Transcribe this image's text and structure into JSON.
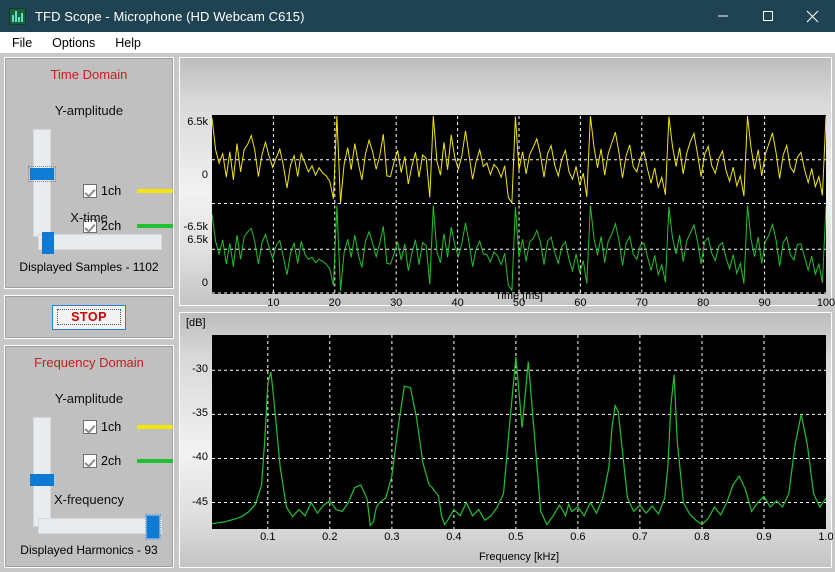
{
  "window": {
    "title": "TFD Scope - Microphone (HD Webcam C615)",
    "icon": "bar-chart-icon",
    "minimize": "minimize-icon",
    "maximize": "maximize-icon",
    "close": "close-icon"
  },
  "menu": {
    "items": [
      "File",
      "Options",
      "Help"
    ]
  },
  "time_domain": {
    "title": "Time Domain",
    "y_label": "Y-amplitude",
    "x_label": "X-time",
    "ch1": {
      "label": "1ch",
      "checked": true,
      "color": "#f3e600"
    },
    "ch2": {
      "label": "2ch",
      "checked": true,
      "color": "#22c030"
    },
    "readout": "Displayed Samples - 1102",
    "y_slider_value": 62,
    "x_slider_value": 3
  },
  "transport": {
    "stop_label": "STOP",
    "stop_color": "#cc0000"
  },
  "frequency_domain": {
    "title": "Frequency Domain",
    "y_label": "Y-amplitude",
    "x_label": "X-frequency",
    "ch1": {
      "label": "1ch",
      "checked": true,
      "color": "#f3e600"
    },
    "ch2": {
      "label": "2ch",
      "checked": true,
      "color": "#22c030"
    },
    "readout": "Displayed Harmonics - 93",
    "y_slider_value": 55,
    "x_slider_value": 97
  },
  "chart_data": [
    {
      "type": "line",
      "name": "time-domain-ch1",
      "title": "",
      "xlabel": "Time [ms]",
      "ylabel": "",
      "xlim": [
        0,
        100
      ],
      "ylim": [
        -6500,
        6500
      ],
      "ytick_labels": [
        "6.5k",
        "0",
        "-6.5k"
      ],
      "ytick_values": [
        6500,
        0,
        -6500
      ],
      "xtick_labels": [
        "10",
        "20",
        "30",
        "40",
        "50",
        "60",
        "70",
        "80",
        "90",
        "100"
      ],
      "xtick_values": [
        10,
        20,
        30,
        40,
        50,
        60,
        70,
        80,
        90,
        100
      ],
      "grid": true,
      "series_color": "#f3e600",
      "background": "#000000",
      "values": [
        6200,
        1500,
        -500,
        900,
        -2600,
        1200,
        -3000,
        2400,
        -1800,
        1500,
        2300,
        3600,
        1400,
        -2500,
        800,
        2600,
        500,
        -1100,
        300,
        1600,
        -900,
        -4200,
        -800,
        600,
        -2500,
        900,
        -400,
        -1800,
        -900,
        -2300,
        -1200,
        -2000,
        -2400,
        -3200,
        -5800,
        6500,
        -6400,
        -700,
        1800,
        -1500,
        2400,
        -600,
        -3000,
        900,
        2900,
        1200,
        -1400,
        600,
        3800,
        -2400,
        -2500,
        -300,
        1400,
        -1900,
        500,
        -3600,
        -900,
        1100,
        -2600,
        700,
        200,
        -5600,
        6500,
        -200,
        -2300,
        2600,
        -1500,
        3700,
        400,
        -1400,
        600,
        4300,
        700,
        -2900,
        -200,
        1500,
        -1000,
        -500,
        -2200,
        -700,
        -1300,
        -2600,
        -900,
        -5600,
        -6400,
        6400,
        -1500,
        1200,
        -2100,
        800,
        1900,
        3100,
        800,
        -2600,
        900,
        2100,
        -800,
        -2400,
        100,
        1400,
        -1800,
        -2900,
        -1000,
        -3800,
        -2000,
        -5500,
        6500,
        1900,
        -1200,
        1600,
        -2300,
        900,
        2500,
        4100,
        1000,
        -2700,
        600,
        2200,
        -1000,
        -1800,
        300,
        1200,
        -1400,
        -3500,
        -1200,
        -4100,
        -2600,
        -5200,
        6400,
        2000,
        -1000,
        1800,
        -2100,
        1000,
        2700,
        3900,
        900,
        -2500,
        800,
        2000,
        -900,
        -2000,
        200,
        1300,
        -1600,
        -3200,
        -1100,
        -3900,
        -2400,
        -5400,
        6500,
        1800,
        -1400,
        1500,
        -2400,
        800,
        2400,
        4000,
        1100,
        -2800,
        700,
        2100,
        -1100,
        -1900,
        400,
        1100,
        -1500,
        -3400,
        -1300,
        -4000,
        -2500,
        -5300,
        6500
      ]
    },
    {
      "type": "line",
      "name": "time-domain-ch2",
      "title": "",
      "xlabel": "Time [ms]",
      "ylabel": "",
      "xlim": [
        0,
        100
      ],
      "ylim": [
        -6500,
        6500
      ],
      "ytick_labels": [
        "6.5k",
        "0",
        "-6.5k"
      ],
      "ytick_values": [
        6500,
        0,
        -6500
      ],
      "grid": true,
      "series_color": "#22c030",
      "background": "#000000",
      "values": [
        5200,
        1200,
        -800,
        1400,
        -2200,
        900,
        -2600,
        2100,
        -1500,
        1800,
        2600,
        3100,
        1100,
        -2200,
        1000,
        2200,
        300,
        -1400,
        600,
        1300,
        -1200,
        -3800,
        -600,
        900,
        -2100,
        1200,
        -700,
        -1500,
        -1200,
        -2000,
        -1500,
        -1800,
        -2200,
        -2900,
        -5400,
        6500,
        -6200,
        -500,
        1500,
        -1200,
        2100,
        -900,
        -2700,
        1200,
        2600,
        900,
        -1100,
        900,
        3400,
        -2100,
        -2200,
        -600,
        1100,
        -1600,
        800,
        -3200,
        -600,
        1400,
        -2300,
        1000,
        500,
        -5200,
        6500,
        -400,
        -2000,
        2300,
        -1200,
        3300,
        700,
        -1100,
        900,
        3900,
        1000,
        -2600,
        100,
        1200,
        -700,
        -800,
        -1900,
        -400,
        -1000,
        -2300,
        -600,
        -5300,
        -6100,
        6300,
        -1200,
        1500,
        -1800,
        1100,
        1600,
        2800,
        1100,
        -2300,
        1200,
        1800,
        -500,
        -2100,
        400,
        1100,
        -1500,
        -3200,
        -700,
        -3500,
        -1700,
        -5100,
        6500,
        1600,
        -900,
        1900,
        -2000,
        1200,
        2200,
        3800,
        1300,
        -2400,
        900,
        1900,
        -700,
        -1500,
        600,
        900,
        -1100,
        -3200,
        -900,
        -3800,
        -2300,
        -4900,
        6300,
        1700,
        -700,
        2100,
        -1800,
        1300,
        2400,
        3600,
        1200,
        -2200,
        1100,
        1700,
        -600,
        -1700,
        500,
        1000,
        -1300,
        -2900,
        -800,
        -3600,
        -2100,
        -5100,
        6500,
        1500,
        -1100,
        1800,
        -2100,
        1100,
        2100,
        3700,
        1400,
        -2500,
        1000,
        1800,
        -800,
        -1600,
        700,
        800,
        -1200,
        -3100,
        -1000,
        -3700,
        -2200,
        -5000,
        6400
      ]
    },
    {
      "type": "line",
      "name": "frequency-domain-spectrum",
      "title": "",
      "xlabel": "Frequency [kHz]",
      "ylabel": "[dB]",
      "xlim": [
        0.01,
        1.0
      ],
      "ylim": [
        -48,
        -26
      ],
      "ytick_labels": [
        "-30",
        "-35",
        "-40",
        "-45"
      ],
      "ytick_values": [
        -30,
        -35,
        -40,
        -45
      ],
      "xtick_labels": [
        "0.1",
        "0.2",
        "0.3",
        "0.4",
        "0.5",
        "0.6",
        "0.7",
        "0.8",
        "0.9",
        "1.0"
      ],
      "xtick_values": [
        0.1,
        0.2,
        0.3,
        0.4,
        0.5,
        0.6,
        0.7,
        0.8,
        0.9,
        1.0
      ],
      "grid": true,
      "series_color": "#22c030",
      "background": "#000000",
      "x": [
        0.01,
        0.02,
        0.03,
        0.04,
        0.05,
        0.06,
        0.07,
        0.08,
        0.09,
        0.095,
        0.1,
        0.105,
        0.11,
        0.12,
        0.13,
        0.14,
        0.15,
        0.16,
        0.17,
        0.18,
        0.19,
        0.2,
        0.21,
        0.22,
        0.23,
        0.24,
        0.25,
        0.26,
        0.265,
        0.27,
        0.275,
        0.28,
        0.29,
        0.3,
        0.31,
        0.32,
        0.33,
        0.34,
        0.35,
        0.36,
        0.365,
        0.37,
        0.375,
        0.38,
        0.385,
        0.39,
        0.4,
        0.41,
        0.42,
        0.43,
        0.44,
        0.45,
        0.46,
        0.47,
        0.48,
        0.49,
        0.5,
        0.51,
        0.52,
        0.53,
        0.54,
        0.55,
        0.56,
        0.57,
        0.575,
        0.58,
        0.585,
        0.59,
        0.6,
        0.61,
        0.62,
        0.63,
        0.64,
        0.65,
        0.655,
        0.66,
        0.665,
        0.67,
        0.68,
        0.69,
        0.7,
        0.71,
        0.72,
        0.73,
        0.74,
        0.745,
        0.75,
        0.755,
        0.76,
        0.77,
        0.78,
        0.79,
        0.8,
        0.81,
        0.82,
        0.83,
        0.84,
        0.85,
        0.86,
        0.87,
        0.88,
        0.89,
        0.9,
        0.91,
        0.92,
        0.93,
        0.94,
        0.95,
        0.96,
        0.97,
        0.98,
        0.99,
        1.0
      ],
      "values": [
        -47.4,
        -47.3,
        -47.2,
        -47.0,
        -46.8,
        -46.5,
        -46.0,
        -45.2,
        -43.0,
        -38.0,
        -31.5,
        -30.2,
        -33.5,
        -41.0,
        -45.5,
        -46.6,
        -45.8,
        -46.5,
        -45.0,
        -46.2,
        -45.3,
        -44.8,
        -45.8,
        -46.0,
        -45.0,
        -43.3,
        -43.0,
        -44.6,
        -47.6,
        -47.2,
        -45.5,
        -45.0,
        -44.5,
        -42.0,
        -36.5,
        -31.8,
        -32.0,
        -35.5,
        -40.5,
        -43.0,
        -43.3,
        -43.8,
        -44.2,
        -46.5,
        -47.5,
        -47.0,
        -45.8,
        -46.5,
        -45.0,
        -46.5,
        -45.8,
        -47.0,
        -46.5,
        -45.5,
        -44.0,
        -36.0,
        -28.5,
        -36.5,
        -29.0,
        -37.5,
        -46.0,
        -47.5,
        -46.5,
        -45.3,
        -45.8,
        -46.5,
        -45.2,
        -46.0,
        -45.5,
        -46.5,
        -45.0,
        -46.2,
        -44.5,
        -41.0,
        -36.5,
        -34.0,
        -34.7,
        -38.0,
        -44.5,
        -46.0,
        -45.3,
        -46.2,
        -45.4,
        -46.3,
        -44.5,
        -41.0,
        -34.0,
        -30.5,
        -38.0,
        -45.0,
        -46.3,
        -47.0,
        -47.5,
        -46.8,
        -45.5,
        -46.4,
        -45.0,
        -43.0,
        -42.0,
        -43.5,
        -46.0,
        -45.0,
        -44.3,
        -45.5,
        -44.8,
        -45.5,
        -44.0,
        -38.5,
        -35.0,
        -38.5,
        -44.0,
        -45.5,
        -44.5,
        -45.8,
        -45.0
      ]
    }
  ]
}
